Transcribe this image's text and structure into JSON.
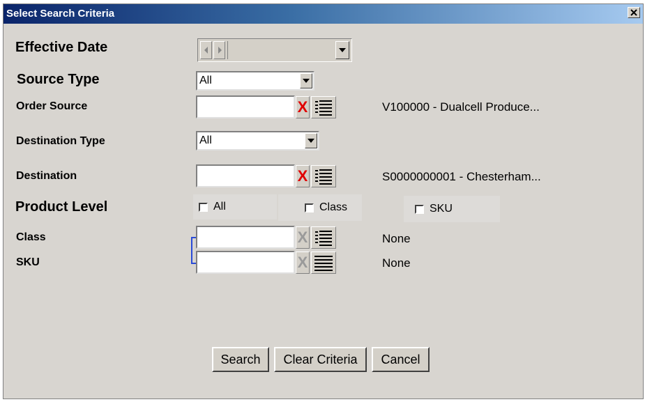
{
  "window": {
    "title": "Select Search Criteria"
  },
  "labels": {
    "effective_date": "Effective Date",
    "source_type": "Source Type",
    "order_source": "Order Source",
    "destination_type": "Destination Type",
    "destination": "Destination",
    "product_level": "Product Level",
    "class": "Class",
    "sku": "SKU"
  },
  "fields": {
    "source_type_selected": "All",
    "destination_type_selected": "All",
    "order_source_value": "",
    "destination_value": "",
    "class_value": "",
    "sku_value": ""
  },
  "clear_glyph": "X",
  "descriptions": {
    "order_source": "V100000 - Dualcell Produce...",
    "destination": "S0000000001 - Chesterham...",
    "class": "None",
    "sku": "None"
  },
  "product_level_options": [
    {
      "label": "All",
      "checked": false
    },
    {
      "label": "Class",
      "checked": false
    },
    {
      "label": "SKU",
      "checked": false
    }
  ],
  "buttons": {
    "search": "Search",
    "clear": "Clear Criteria",
    "cancel": "Cancel"
  },
  "colors": {
    "titlebar_start": "#0a246a",
    "titlebar_end": "#a6caf0",
    "dialog_bg": "#d8d5d0",
    "clear_active": "#e00000",
    "link_line": "#2a4bd8"
  },
  "icons": {
    "close": "close-icon",
    "clear": "clear-x-icon",
    "list": "list-lookup-icon",
    "dropdown": "chevron-down-icon",
    "left": "arrow-left-icon",
    "right": "arrow-right-icon"
  }
}
